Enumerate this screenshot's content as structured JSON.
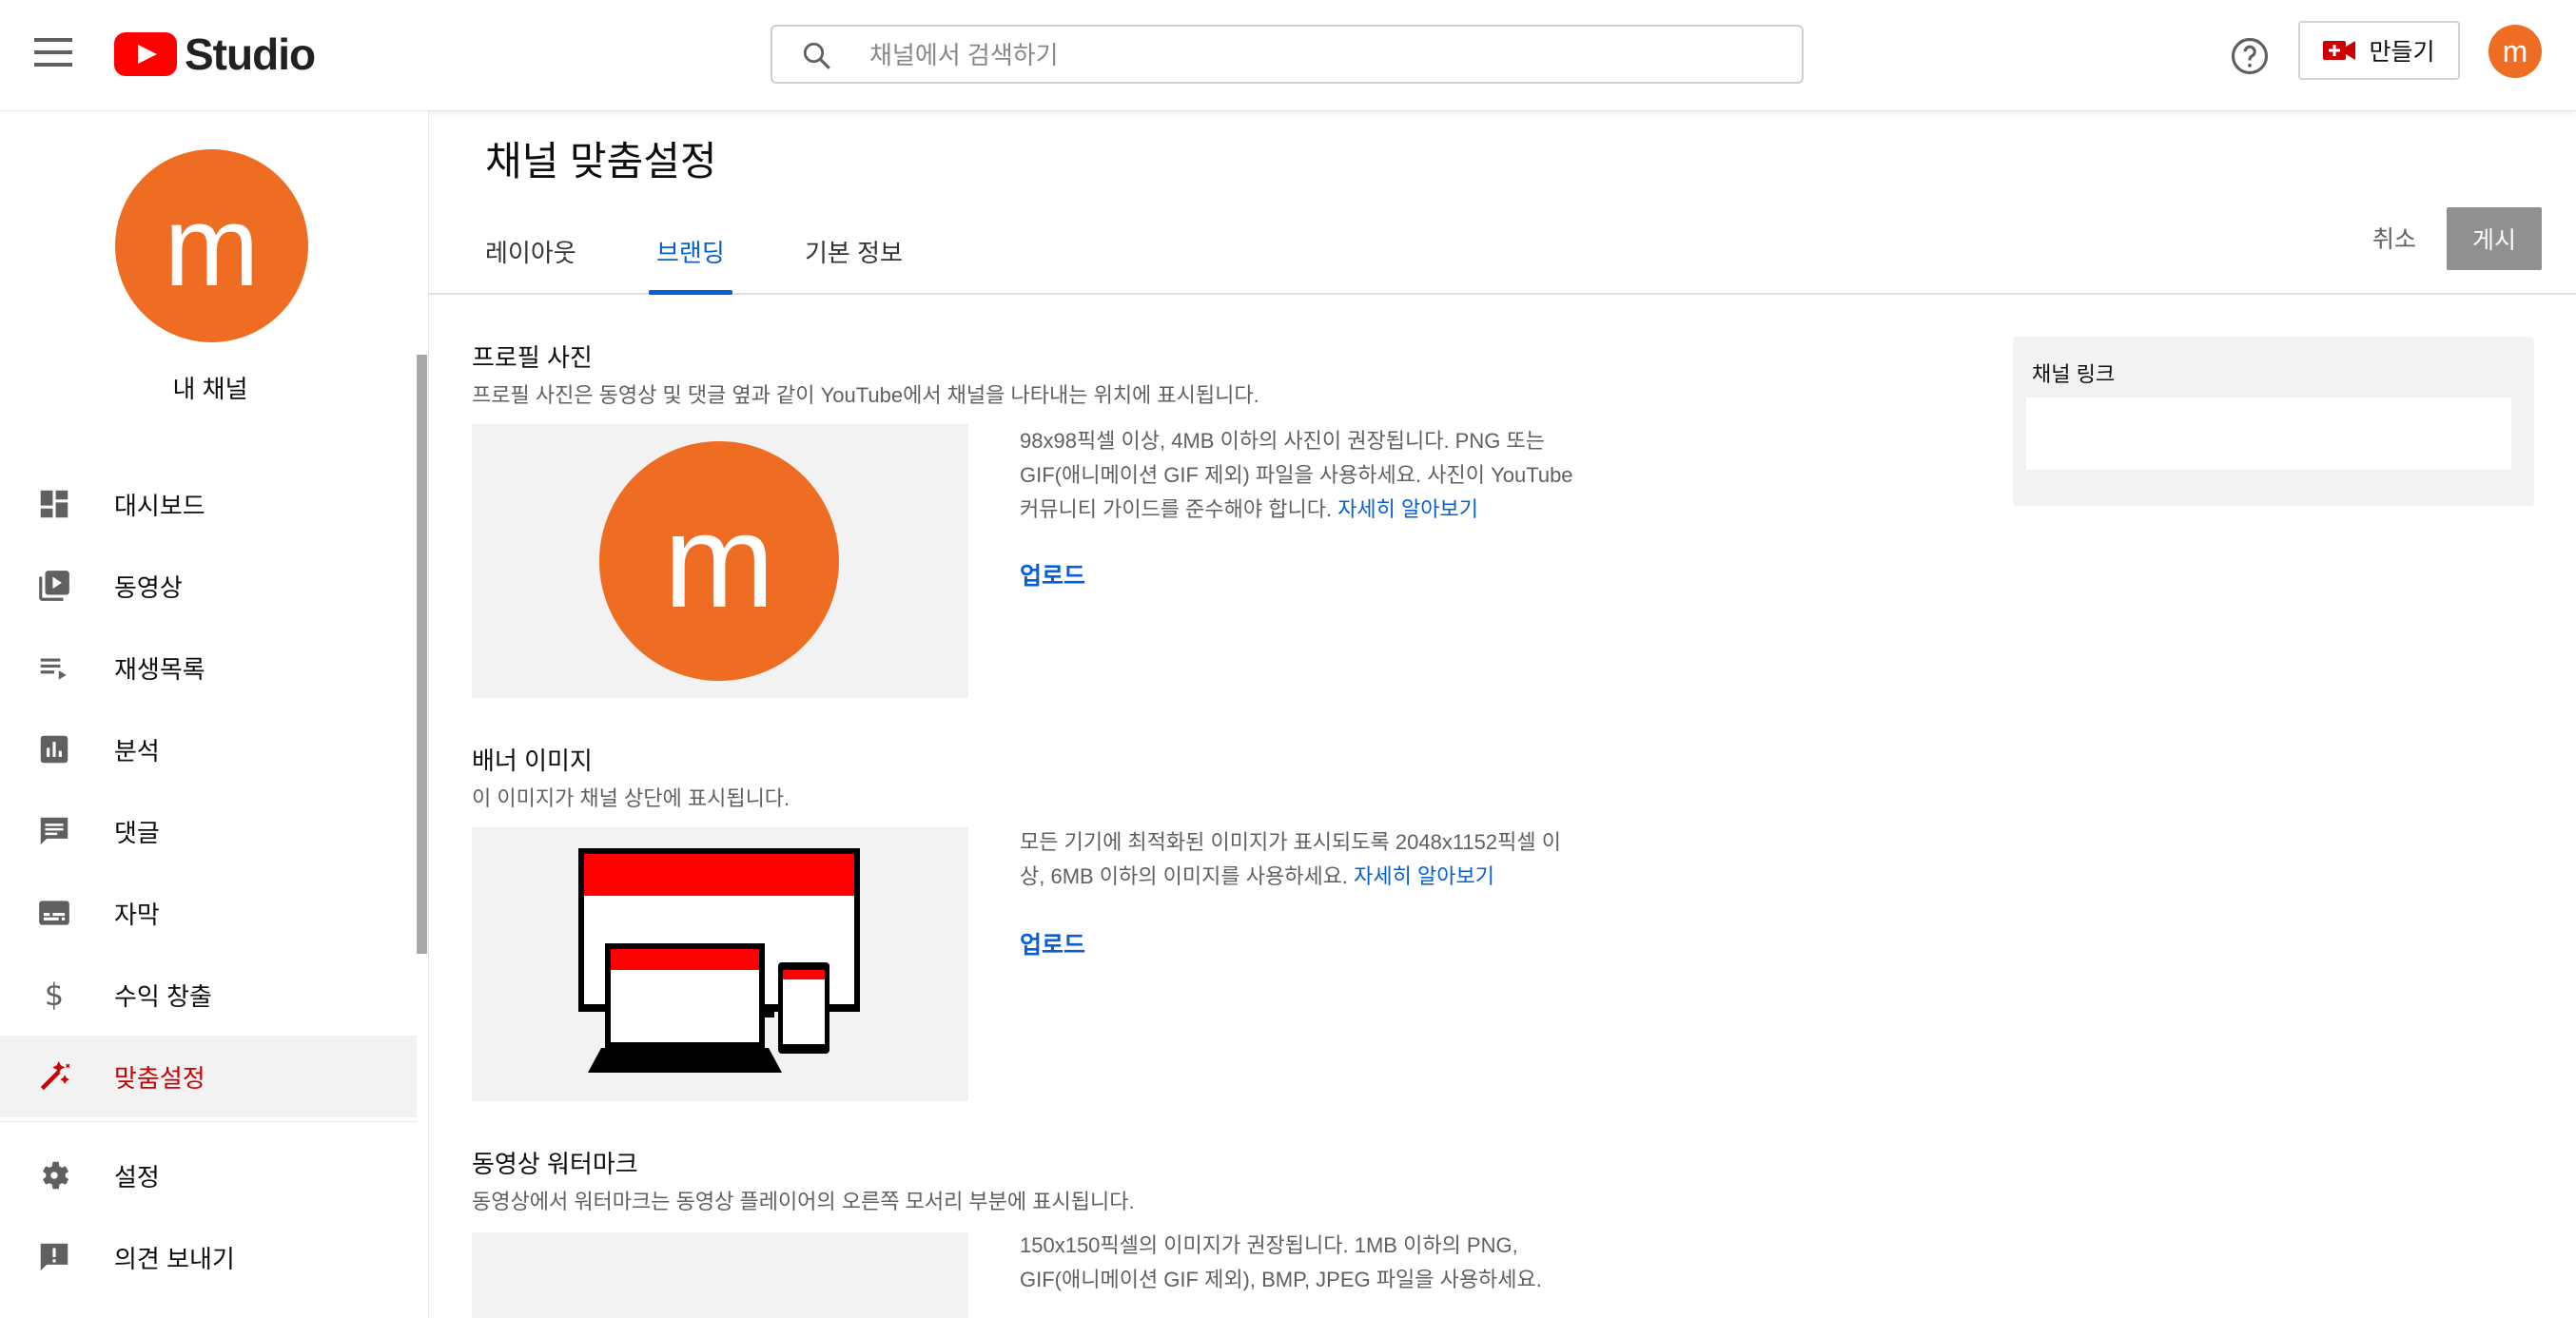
{
  "header": {
    "logo_text": "Studio",
    "search_placeholder": "채널에서 검색하기",
    "create_label": "만들기",
    "avatar_letter": "m"
  },
  "sidebar": {
    "avatar_letter": "m",
    "channel_label": "내 채널",
    "items": [
      {
        "label": "대시보드",
        "icon": "dashboard-icon"
      },
      {
        "label": "동영상",
        "icon": "video-library-icon"
      },
      {
        "label": "재생목록",
        "icon": "playlist-icon"
      },
      {
        "label": "분석",
        "icon": "analytics-icon"
      },
      {
        "label": "댓글",
        "icon": "comments-icon"
      },
      {
        "label": "자막",
        "icon": "subtitles-icon"
      },
      {
        "label": "수익 창출",
        "icon": "dollar-icon"
      },
      {
        "label": "맞춤설정",
        "icon": "magic-wand-icon",
        "active": true
      }
    ],
    "bottom_items": [
      {
        "label": "설정",
        "icon": "gear-icon"
      },
      {
        "label": "의견 보내기",
        "icon": "feedback-icon"
      }
    ]
  },
  "main": {
    "title": "채널 맞춤설정",
    "tabs": [
      {
        "label": "레이아웃"
      },
      {
        "label": "브랜딩",
        "active": true
      },
      {
        "label": "기본 정보"
      }
    ],
    "cancel_label": "취소",
    "publish_label": "게시",
    "profile": {
      "title": "프로필 사진",
      "desc": "프로필 사진은 동영상 및 댓글 옆과 같이 YouTube에서 채널을 나타내는 위치에 표시됩니다.",
      "preview_letter": "m",
      "info_line1": "98x98픽셀 이상, 4MB 이하의 사진이 권장됩니다. PNG 또는",
      "info_line2": "GIF(애니메이션 GIF 제외) 파일을 사용하세요. 사진이 YouTube",
      "info_line3": "커뮤니티 가이드를 준수해야 합니다.",
      "learn_more": "자세히 알아보기",
      "upload": "업로드"
    },
    "banner": {
      "title": "배너 이미지",
      "desc": "이 이미지가 채널 상단에 표시됩니다.",
      "info_line1": "모든 기기에 최적화된 이미지가 표시되도록 2048x1152픽셀 이",
      "info_line2": "상, 6MB 이하의 이미지를 사용하세요.",
      "learn_more": "자세히 알아보기",
      "upload": "업로드"
    },
    "watermark": {
      "title": "동영상 워터마크",
      "desc": "동영상에서 워터마크는 동영상 플레이어의 오른쪽 모서리 부분에 표시됩니다.",
      "info_line1": "150x150픽셀의 이미지가 권장됩니다. 1MB 이하의 PNG,",
      "info_line2": "GIF(애니메이션 GIF 제외), BMP, JPEG 파일을 사용하세요."
    },
    "channel_link": {
      "title": "채널 링크"
    }
  },
  "colors": {
    "brand_red": "#ff0000",
    "active_red": "#cc0000",
    "link_blue": "#065fd4",
    "avatar_orange": "#ef6d22"
  }
}
